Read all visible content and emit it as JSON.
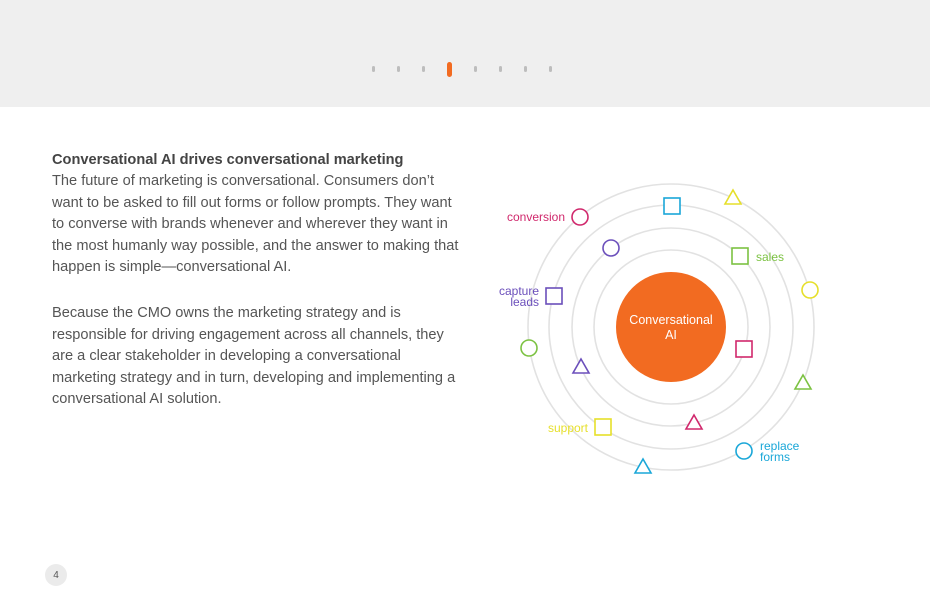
{
  "pagination": {
    "dot_count": 8,
    "active_index": 3,
    "colors": {
      "inactive": "#bdbdbd",
      "active": "#f26b21"
    }
  },
  "content": {
    "heading": "Conversational AI drives conversational marketing",
    "paragraph1": "The future of marketing is conversational. Consumers don’t want to be asked to fill out forms or follow prompts. They want to converse with brands whenever and wherever they want in the most humanly way possible, and the answer to making that happen is simple—conversational AI.",
    "paragraph2": "Because the CMO owns the marketing strategy and is responsible for driving engagement across all channels, they are a clear stakeholder in developing a conversational marketing strategy and in turn, developing and implementing a conversational AI solution."
  },
  "diagram": {
    "center_label_line1": "Conversational",
    "center_label_line2": "AI",
    "center_color": "#f26b21",
    "labels": {
      "conversion": "conversion",
      "sales": "sales",
      "capture": "capture",
      "leads": "leads",
      "support": "support",
      "replace": "replace",
      "forms": "forms"
    },
    "colors": {
      "conversion": "#d0286c",
      "sales": "#7cc242",
      "capture_leads": "#6b4fbb",
      "support": "#e6df2a",
      "replace_forms": "#1aa7d8",
      "ring": "#e2e2e2"
    }
  },
  "page_number": "4"
}
